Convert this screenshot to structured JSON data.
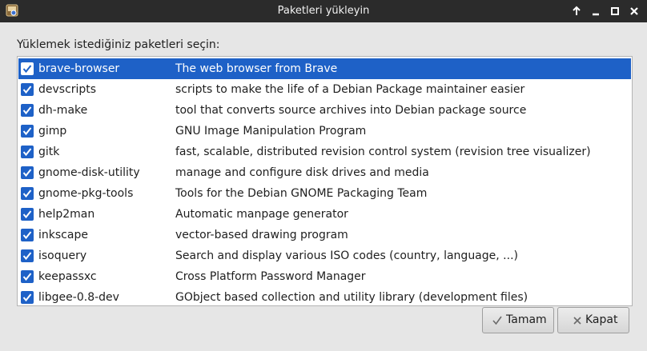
{
  "window": {
    "title": "Paketleri yükleyin"
  },
  "prompt": "Yüklemek istediğiniz paketleri seçin:",
  "packages": [
    {
      "name": "brave-browser",
      "description": "The web browser from Brave",
      "checked": true,
      "selected": true
    },
    {
      "name": "devscripts",
      "description": "scripts to make the life of a Debian Package maintainer easier",
      "checked": true
    },
    {
      "name": "dh-make",
      "description": "tool that converts source archives into Debian package source",
      "checked": true
    },
    {
      "name": "gimp",
      "description": "GNU Image Manipulation Program",
      "checked": true
    },
    {
      "name": "gitk",
      "description": "fast, scalable, distributed revision control system (revision tree visualizer)",
      "checked": true
    },
    {
      "name": "gnome-disk-utility",
      "description": "manage and configure disk drives and media",
      "checked": true
    },
    {
      "name": "gnome-pkg-tools",
      "description": "Tools for the Debian GNOME Packaging Team",
      "checked": true
    },
    {
      "name": "help2man",
      "description": "Automatic manpage generator",
      "checked": true
    },
    {
      "name": "inkscape",
      "description": "vector-based drawing program",
      "checked": true
    },
    {
      "name": "isoquery",
      "description": "Search and display various ISO codes (country, language, ...)",
      "checked": true
    },
    {
      "name": "keepassxc",
      "description": "Cross Platform Password Manager",
      "checked": true
    },
    {
      "name": "libgee-0.8-dev",
      "description": "GObject based collection and utility library (development files)",
      "checked": true
    }
  ],
  "buttons": {
    "ok_label": "Tamam",
    "close_label": "Kapat"
  },
  "colors": {
    "selection": "#1e61c7",
    "titlebar": "#2b2b2b",
    "dialog_bg": "#e6e6e6"
  },
  "icons": [
    "package-icon",
    "shade-arrow-icon",
    "minimize-icon",
    "maximize-icon",
    "close-icon",
    "checkmark-icon",
    "x-icon"
  ]
}
